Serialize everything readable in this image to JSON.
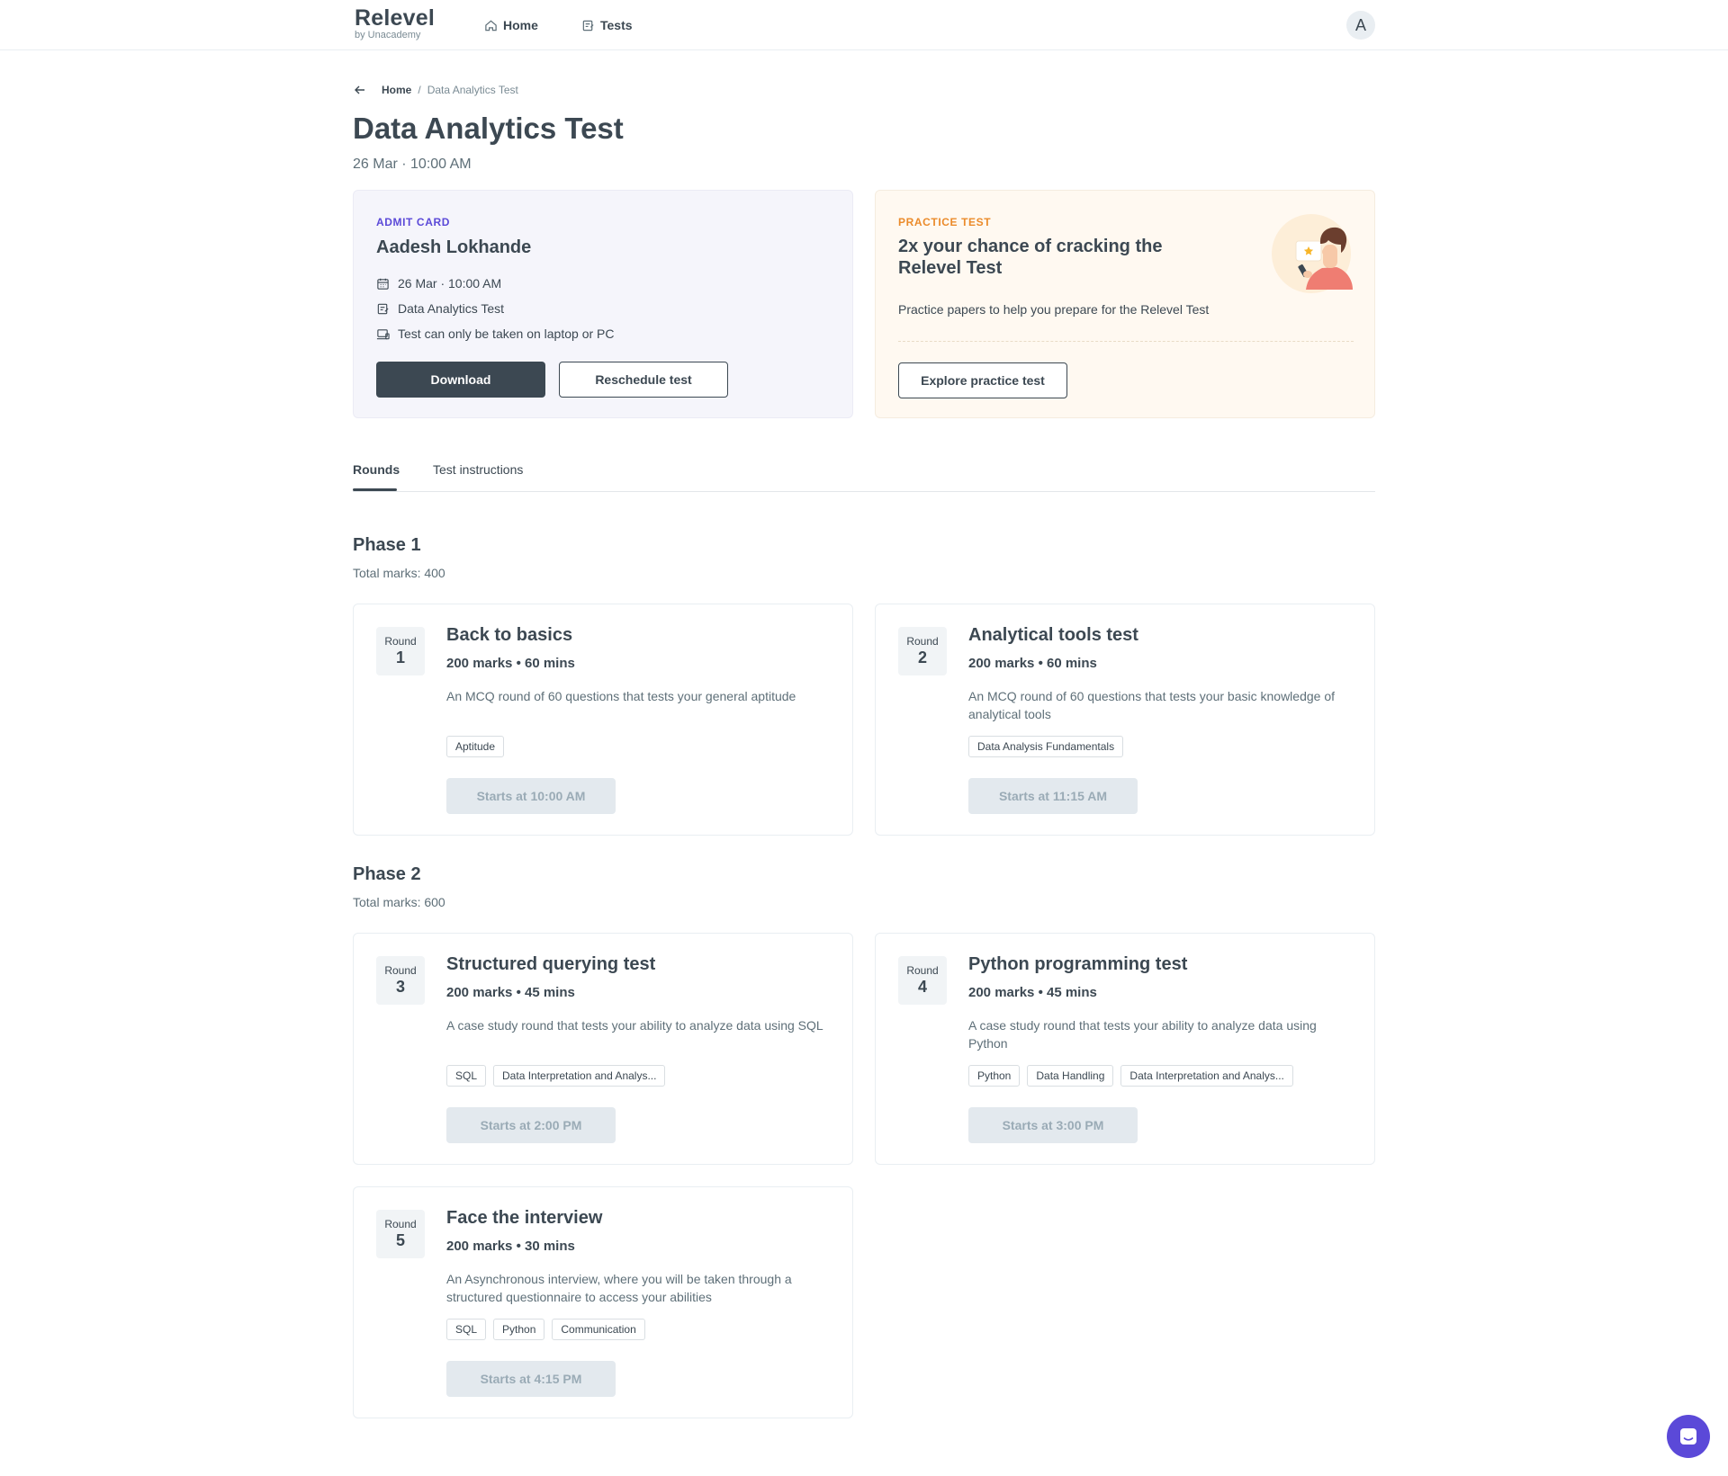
{
  "nav": {
    "brand": "Relevel",
    "brand_sub": "by Unacademy",
    "home": "Home",
    "tests": "Tests",
    "avatar_initial": "A"
  },
  "breadcrumb": {
    "home": "Home",
    "separator": "/",
    "current": "Data Analytics Test"
  },
  "page": {
    "title": "Data Analytics Test",
    "subtitle": "26 Mar · 10:00 AM"
  },
  "admit_card": {
    "overline": "ADMIT CARD",
    "name": "Aadesh Lokhande",
    "items": [
      {
        "icon": "calendar-icon",
        "text": "26 Mar · 10:00 AM"
      },
      {
        "icon": "test-icon",
        "text": "Data Analytics Test"
      },
      {
        "icon": "laptop-icon",
        "text": "Test can only be taken on laptop or PC"
      }
    ],
    "download_label": "Download",
    "reschedule_label": "Reschedule test"
  },
  "practice_card": {
    "overline": "PRACTICE TEST",
    "headline": "2x your chance of cracking the Relevel Test",
    "description": "Practice papers to help you prepare for the Relevel Test",
    "button_label": "Explore practice test"
  },
  "tabs": [
    {
      "label": "Rounds",
      "active": true
    },
    {
      "label": "Test instructions",
      "active": false
    }
  ],
  "phases": [
    {
      "title": "Phase 1",
      "marks": "Total marks: 400",
      "rounds": [
        {
          "round_label": "Round",
          "number": "1",
          "title": "Back to basics",
          "meta": "200 marks • 60 mins",
          "description": "An MCQ round of 60 questions that tests your general aptitude",
          "tags": [
            "Aptitude"
          ],
          "start": "Starts at 10:00 AM"
        },
        {
          "round_label": "Round",
          "number": "2",
          "title": "Analytical tools test",
          "meta": "200 marks • 60 mins",
          "description": "An MCQ round of 60 questions that tests your basic knowledge of analytical tools",
          "tags": [
            "Data Analysis Fundamentals"
          ],
          "start": "Starts at 11:15 AM"
        }
      ]
    },
    {
      "title": "Phase 2",
      "marks": "Total marks: 600",
      "rounds": [
        {
          "round_label": "Round",
          "number": "3",
          "title": "Structured querying test",
          "meta": "200 marks • 45 mins",
          "description": "A case study round that tests your ability to analyze data using SQL",
          "tags": [
            "SQL",
            "Data Interpretation and Analys..."
          ],
          "start": "Starts at 2:00 PM"
        },
        {
          "round_label": "Round",
          "number": "4",
          "title": "Python programming test",
          "meta": "200 marks • 45 mins",
          "description": "A case study round that tests your ability to analyze data using Python",
          "tags": [
            "Python",
            "Data Handling",
            "Data Interpretation and Analys..."
          ],
          "start": "Starts at 3:00 PM"
        },
        {
          "round_label": "Round",
          "number": "5",
          "title": "Face the interview",
          "meta": "200 marks • 30 mins",
          "description": "An Asynchronous interview, where you will be taken through a structured questionnaire to access your abilities",
          "tags": [
            "SQL",
            "Python",
            "Communication"
          ],
          "start": "Starts at 4:15 PM"
        }
      ]
    }
  ],
  "colors": {
    "text": "#3c4852",
    "admit_accent": "#5b49d8",
    "practice_accent": "#eb8b2b",
    "chat": "#5b49d8"
  }
}
